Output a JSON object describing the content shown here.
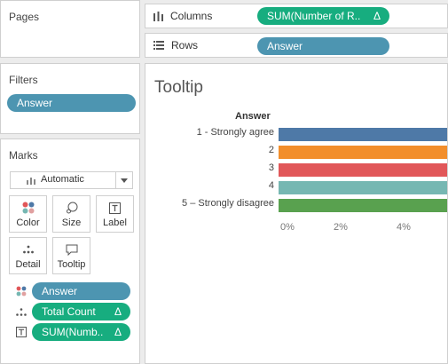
{
  "pages": {
    "title": "Pages"
  },
  "columns": {
    "label": "Columns",
    "pill": "SUM(Number of R..",
    "delta": "Δ"
  },
  "rows": {
    "label": "Rows",
    "pill": "Answer"
  },
  "filters": {
    "title": "Filters",
    "pill": "Answer"
  },
  "marks": {
    "title": "Marks",
    "mark_type": "Automatic",
    "buttons": {
      "color": "Color",
      "size": "Size",
      "label": "Label",
      "detail": "Detail",
      "tooltip": "Tooltip"
    },
    "fields": [
      {
        "icon": "color-dots-icon",
        "label": "Answer",
        "color": "#4d95b1"
      },
      {
        "icon": "detail-dots-icon",
        "label": "Total Count",
        "delta": "Δ",
        "color": "#17ad7f"
      },
      {
        "icon": "label-t-icon",
        "label": "SUM(Numb..",
        "delta": "Δ",
        "color": "#17ad7f"
      }
    ]
  },
  "viz": {
    "title": "Tooltip",
    "row_header": "Answer",
    "chart_data": {
      "type": "bar",
      "orientation": "horizontal",
      "categories": [
        "1 - Strongly agree",
        "2",
        "3",
        "4",
        "5 – Strongly disagree"
      ],
      "colors": [
        "#4e79a7",
        "#f28e2b",
        "#e15759",
        "#76b7b2",
        "#59a14f"
      ],
      "x_ticks": [
        "0%",
        "2%",
        "4%"
      ],
      "note": "bars extend past the visible right edge"
    }
  }
}
